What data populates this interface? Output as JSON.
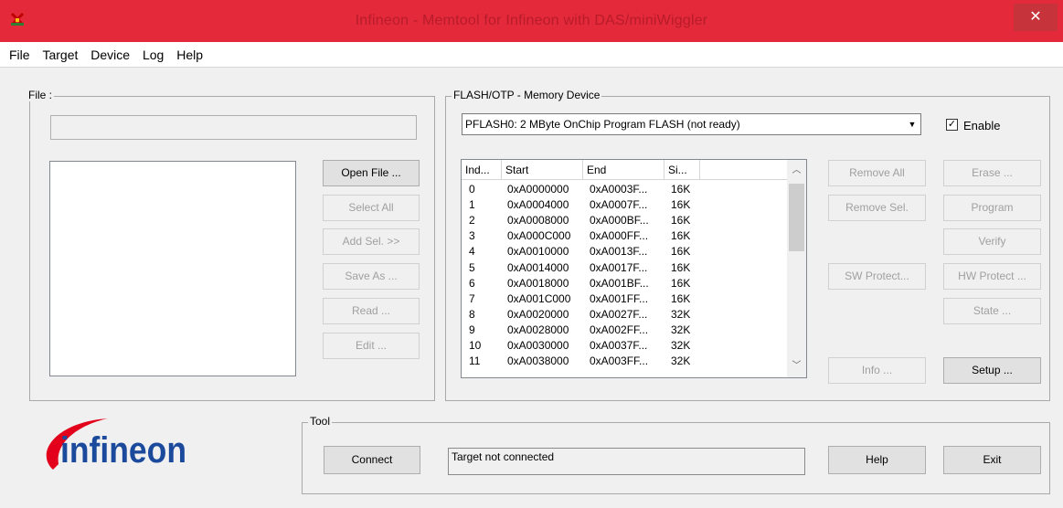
{
  "window": {
    "title": "Infineon - Memtool for Infineon with DAS/miniWiggler",
    "close_glyph": "✕"
  },
  "menu": [
    "File",
    "Target",
    "Device",
    "Log",
    "Help"
  ],
  "file_panel": {
    "legend": "File :",
    "path_value": "",
    "buttons": {
      "open_file": "Open File ...",
      "select_all": "Select All",
      "add_sel": "Add Sel. >>",
      "save_as": "Save As ...",
      "read": "Read ...",
      "edit": "Edit ..."
    }
  },
  "memory_panel": {
    "legend": "FLASH/OTP - Memory Device",
    "device_selected": "PFLASH0: 2 MByte OnChip Program FLASH  (not ready)",
    "enable_label": "Enable",
    "enable_checked": true,
    "columns": [
      "Ind...",
      "Start",
      "End",
      "Si..."
    ],
    "rows": [
      {
        "index": "0",
        "start": "0xA0000000",
        "end": "0xA0003F...",
        "size": "16K"
      },
      {
        "index": "1",
        "start": "0xA0004000",
        "end": "0xA0007F...",
        "size": "16K"
      },
      {
        "index": "2",
        "start": "0xA0008000",
        "end": "0xA000BF...",
        "size": "16K"
      },
      {
        "index": "3",
        "start": "0xA000C000",
        "end": "0xA000FF...",
        "size": "16K"
      },
      {
        "index": "4",
        "start": "0xA0010000",
        "end": "0xA0013F...",
        "size": "16K"
      },
      {
        "index": "5",
        "start": "0xA0014000",
        "end": "0xA0017F...",
        "size": "16K"
      },
      {
        "index": "6",
        "start": "0xA0018000",
        "end": "0xA001BF...",
        "size": "16K"
      },
      {
        "index": "7",
        "start": "0xA001C000",
        "end": "0xA001FF...",
        "size": "16K"
      },
      {
        "index": "8",
        "start": "0xA0020000",
        "end": "0xA0027F...",
        "size": "32K"
      },
      {
        "index": "9",
        "start": "0xA0028000",
        "end": "0xA002FF...",
        "size": "32K"
      },
      {
        "index": "10",
        "start": "0xA0030000",
        "end": "0xA0037F...",
        "size": "32K"
      },
      {
        "index": "11",
        "start": "0xA0038000",
        "end": "0xA003FF...",
        "size": "32K"
      }
    ],
    "buttons": {
      "remove_all": "Remove All",
      "remove_sel": "Remove Sel.",
      "sw_protect": "SW Protect...",
      "info": "Info ...",
      "erase": "Erase ...",
      "program": "Program",
      "verify": "Verify",
      "hw_protect": "HW Protect ...",
      "state": "State ...",
      "setup": "Setup ..."
    }
  },
  "tool_panel": {
    "legend": "Tool",
    "connect": "Connect",
    "status": "Target not connected",
    "help": "Help",
    "exit": "Exit"
  },
  "logo": {
    "text": "infineon",
    "color": "#1b4a9c",
    "swoosh_color": "#e2001a"
  }
}
